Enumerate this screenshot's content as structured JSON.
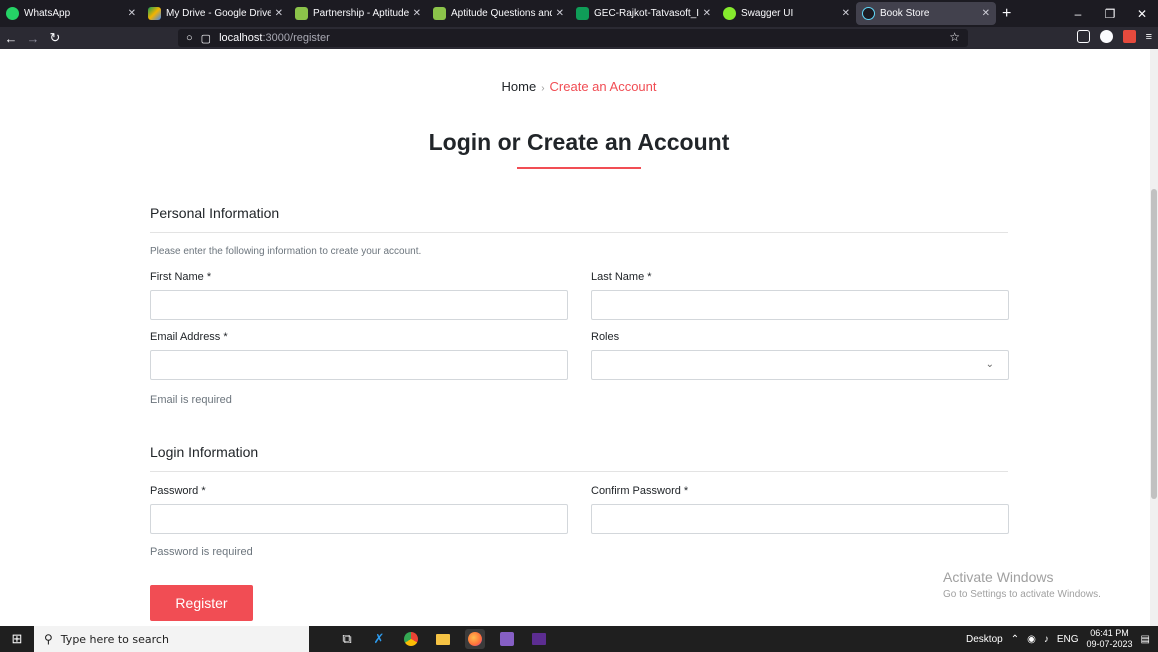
{
  "browser": {
    "tabs": [
      {
        "title": "WhatsApp",
        "favicon": "whatsapp-icon",
        "color": "#25d366"
      },
      {
        "title": "My Drive - Google Drive",
        "favicon": "google-drive-icon",
        "color": "#f4b400"
      },
      {
        "title": "Partnership - Aptitude Q",
        "favicon": "leaf-icon",
        "color": "#8bc34a"
      },
      {
        "title": "Aptitude Questions and A",
        "favicon": "leaf-icon",
        "color": "#8bc34a"
      },
      {
        "title": "GEC-Rajkot-Tatvasoft_Int",
        "favicon": "sheets-icon",
        "color": "#0f9d58"
      },
      {
        "title": "Swagger UI",
        "favicon": "swagger-icon",
        "color": "#85ea2d"
      },
      {
        "title": "Book Store",
        "favicon": "react-icon",
        "color": "#61dafb"
      }
    ],
    "url_host": "localhost",
    "url_path": ":3000/register"
  },
  "page": {
    "breadcrumb": {
      "home": "Home",
      "separator": "›",
      "current": "Create an Account"
    },
    "heading": "Login or Create an Account",
    "personal_section": {
      "title": "Personal Information",
      "hint": "Please enter the following information to create your account.",
      "first_name_label": "First Name *",
      "last_name_label": "Last Name *",
      "email_label": "Email Address *",
      "roles_label": "Roles",
      "email_error": "Email is required"
    },
    "login_section": {
      "title": "Login Information",
      "password_label": "Password *",
      "confirm_password_label": "Confirm Password *",
      "password_error": "Password is required"
    },
    "register_button": "Register"
  },
  "watermark": {
    "title": "Activate Windows",
    "subtitle": "Go to Settings to activate Windows."
  },
  "taskbar": {
    "search_placeholder": "Type here to search",
    "desktop_label": "Desktop",
    "language": "ENG",
    "time": "06:41 PM",
    "date": "09-07-2023"
  },
  "colors": {
    "accent": "#f14d54"
  }
}
